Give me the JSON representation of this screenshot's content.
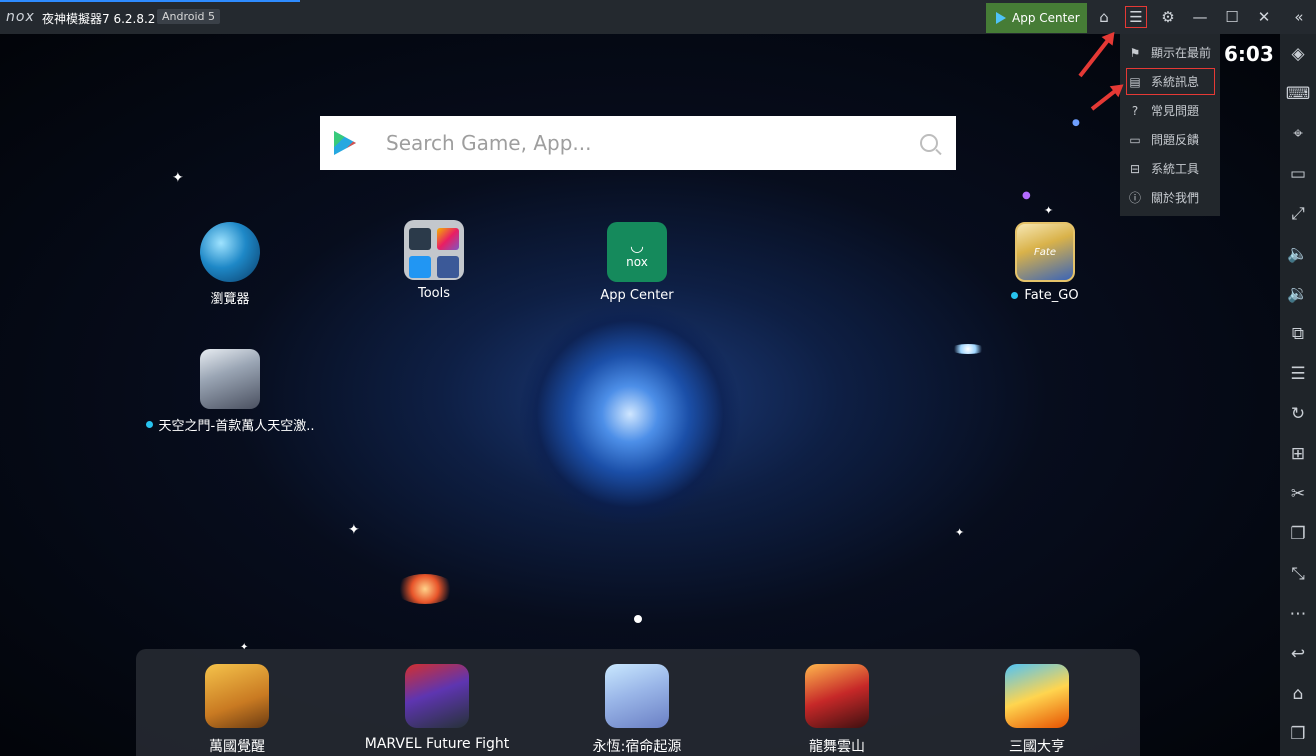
{
  "window": {
    "logo": "nox",
    "title": "夜神模擬器7 6.2.8.2",
    "android_badge": "Android 5",
    "app_center_button": "App Center",
    "accent": "#467c36"
  },
  "titlebar_icons": [
    "shirt-icon",
    "menu-icon",
    "gear-icon",
    "minimize-icon",
    "maximize-icon",
    "close-icon",
    "collapse-icon"
  ],
  "clock": "6:03",
  "search": {
    "placeholder": "Search Game, App..."
  },
  "desktop_apps": [
    {
      "label": "瀏覽器",
      "dot": false
    },
    {
      "label": "Tools",
      "dot": false
    },
    {
      "label": "App Center",
      "dot": false
    },
    {
      "label": "Fate_GO",
      "dot": true
    },
    {
      "label": "天空之門-首款萬人天空激..",
      "dot": true
    }
  ],
  "dock_apps": [
    {
      "label": "萬國覺醒"
    },
    {
      "label": "MARVEL Future Fight"
    },
    {
      "label": "永恆:宿命起源"
    },
    {
      "label": "龍舞雲山"
    },
    {
      "label": "三國大亨"
    }
  ],
  "menu": {
    "items": [
      {
        "label": "顯示在最前",
        "icon": "pin-icon"
      },
      {
        "label": "系統訊息",
        "icon": "info-panel-icon",
        "highlighted": true
      },
      {
        "label": "常見問題",
        "icon": "question-icon"
      },
      {
        "label": "問題反饋",
        "icon": "feedback-icon"
      },
      {
        "label": "系統工具",
        "icon": "toolbox-icon"
      },
      {
        "label": "關於我們",
        "icon": "about-icon"
      }
    ]
  },
  "sidebar_icons": [
    "rotate-icon",
    "keyboard-icon",
    "location-icon",
    "screen-icon",
    "fullscreen-icon",
    "volume-up-icon",
    "volume-down-icon",
    "screenshot-icon",
    "apk-install-icon",
    "macro-icon",
    "add-apk-icon",
    "scissors-icon",
    "multi-instance-icon",
    "resize-icon",
    "more-icon",
    "back-icon",
    "home-icon",
    "recent-apps-icon"
  ]
}
